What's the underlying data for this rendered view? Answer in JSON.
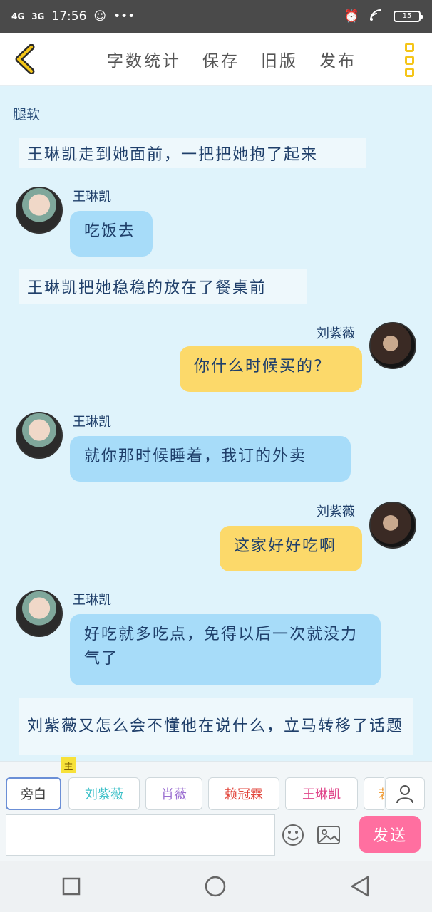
{
  "status_bar": {
    "network1": "4G",
    "network2": "3G",
    "time": "17:56",
    "more": "•••",
    "battery": "15"
  },
  "toolbar": {
    "word_count": "字数统计",
    "save": "保存",
    "old_version": "旧版",
    "publish": "发布"
  },
  "chat": {
    "title": "腿软",
    "messages": [
      {
        "kind": "narration",
        "text": "王琳凯走到她面前，一把把她抱了起来"
      },
      {
        "kind": "left",
        "speaker": "王琳凯",
        "text": "吃饭去"
      },
      {
        "kind": "narration",
        "text": "王琳凯把她稳稳的放在了餐桌前"
      },
      {
        "kind": "right",
        "speaker": "刘紫薇",
        "text": "你什么时候买的？"
      },
      {
        "kind": "left",
        "speaker": "王琳凯",
        "text": "就你那时候睡着，我订的外卖"
      },
      {
        "kind": "right",
        "speaker": "刘紫薇",
        "text": "这家好好吃啊"
      },
      {
        "kind": "left",
        "speaker": "王琳凯",
        "text": "好吃就多吃点，免得以后一次就没力气了"
      },
      {
        "kind": "narration",
        "text": "刘紫薇又怎么会不懂他在说什么，立马转移了话题"
      }
    ]
  },
  "composer": {
    "roles": [
      {
        "label": "旁白",
        "color": "#3a3a3a"
      },
      {
        "label": "刘紫薇",
        "color": "#3fc1c9"
      },
      {
        "label": "肖薇",
        "color": "#9b6fd1"
      },
      {
        "label": "赖冠霖",
        "color": "#e2463c"
      },
      {
        "label": "王琳凯",
        "color": "#e0468a"
      },
      {
        "label": "若",
        "color": "#f0a040"
      }
    ],
    "main_badge": "主",
    "input_value": "",
    "send": "发送"
  }
}
